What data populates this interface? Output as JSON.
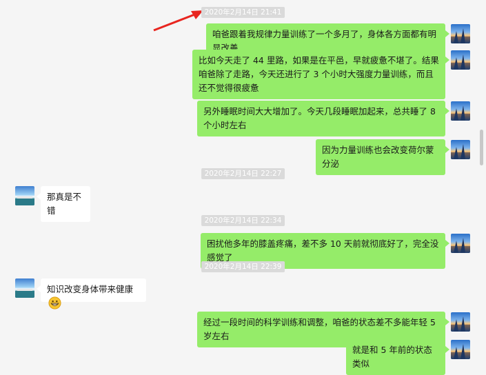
{
  "colors": {
    "my_bubble": "#95ec69",
    "other_bubble": "#ffffff",
    "background": "#f5f5f5",
    "annotation_arrow": "#e8251f"
  },
  "timestamps": [
    "2020年2月14日 21:41",
    "2020年2月14日 22:27",
    "2020年2月14日 22:34",
    "2020年2月14日 22:39"
  ],
  "messages": [
    {
      "sender": "me",
      "text": "咱爸跟着我规律力量训练了一个多月了，身体各方面都有明显改善"
    },
    {
      "sender": "me",
      "text": "比如今天走了 44 里路，如果是在平邑，早就疲惫不堪了。结果咱爸除了走路，今天还进行了 3 个小时大强度力量训练，而且还不觉得很疲惫"
    },
    {
      "sender": "me",
      "text": "另外睡眠时间大大增加了。今天几段睡眠加起来，总共睡了 8 个小时左右"
    },
    {
      "sender": "me",
      "text": "因为力量训练也会改变荷尔蒙分泌"
    },
    {
      "sender": "other",
      "text": "那真是不错"
    },
    {
      "sender": "me",
      "text": "困扰他多年的膝盖疼痛，差不多 10 天前就彻底好了，完全没感觉了"
    },
    {
      "sender": "other",
      "text": "知识改变身体带来健康",
      "emoji": "grinning-face-icon"
    },
    {
      "sender": "me",
      "text": "经过一段时间的科学训练和调整，咱爸的状态差不多能年轻 5 岁左右"
    },
    {
      "sender": "me",
      "text": "就是和 5 年前的状态类似"
    }
  ]
}
